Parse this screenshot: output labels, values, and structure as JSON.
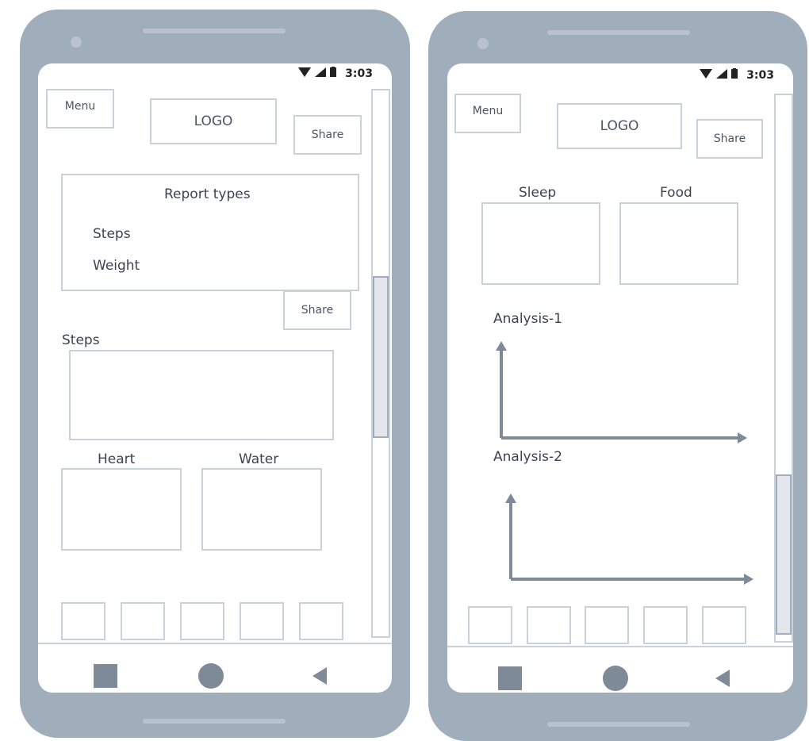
{
  "status_bar": {
    "time": "3:03"
  },
  "screen_left": {
    "menu_label": "Menu",
    "logo_label": "LOGO",
    "share_label": "Share",
    "report_types": {
      "title": "Report types",
      "items": [
        "Steps",
        "Weight"
      ]
    },
    "report_share_label": "Share",
    "steps_label": "Steps",
    "heart_label": "Heart",
    "water_label": "Water"
  },
  "screen_right": {
    "menu_label": "Menu",
    "logo_label": "LOGO",
    "share_label": "Share",
    "sleep_label": "Sleep",
    "food_label": "Food",
    "analysis_1_label": "Analysis-1",
    "analysis_2_label": "Analysis-2"
  },
  "icons": {
    "wifi": "wifi-icon",
    "signal": "signal-icon",
    "battery": "battery-icon",
    "nav_recent": "square-icon",
    "nav_home": "circle-icon",
    "nav_back": "triangle-back-icon"
  },
  "colors": {
    "phone_frame": "#a0adbb",
    "wireframe_border": "#c9d1da",
    "nav_icon": "#7e8a98",
    "axis": "#7e8a98"
  }
}
